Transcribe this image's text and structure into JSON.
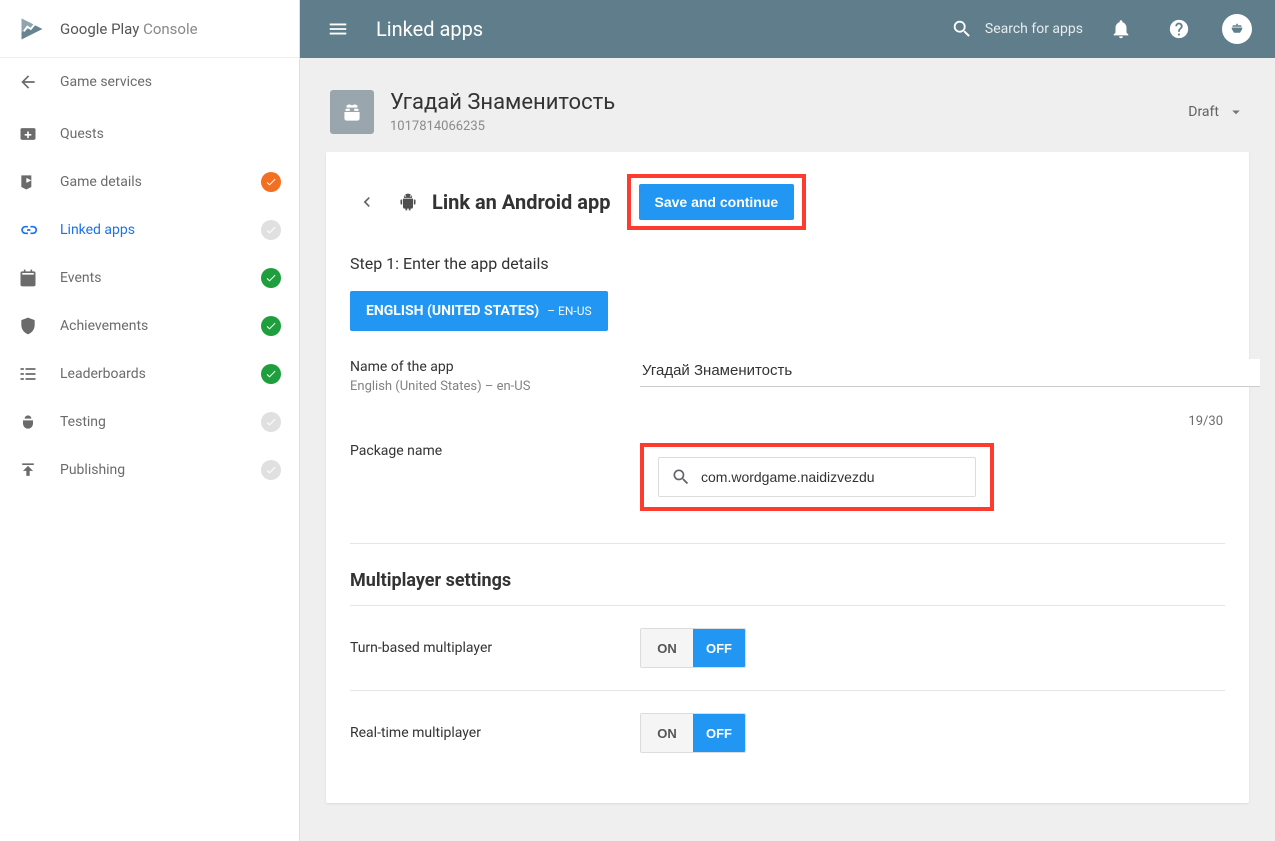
{
  "brand": {
    "name_strong": "Google Play",
    "name_light": " Console"
  },
  "sidebar": {
    "back_label": "Game services",
    "items": [
      {
        "label": "Quests",
        "icon": "add",
        "status": "none"
      },
      {
        "label": "Game details",
        "icon": "card",
        "status": "orange"
      },
      {
        "label": "Linked apps",
        "icon": "link",
        "status": "gray",
        "active": true
      },
      {
        "label": "Events",
        "icon": "event",
        "status": "green"
      },
      {
        "label": "Achievements",
        "icon": "shield",
        "status": "green"
      },
      {
        "label": "Leaderboards",
        "icon": "list",
        "status": "green"
      },
      {
        "label": "Testing",
        "icon": "bug",
        "status": "gray"
      },
      {
        "label": "Publishing",
        "icon": "publish",
        "status": "gray"
      }
    ]
  },
  "topbar": {
    "title": "Linked apps",
    "search_placeholder": "Search for apps"
  },
  "appHeader": {
    "title": "Угадай Знаменитость",
    "id": "1017814066235",
    "status": "Draft"
  },
  "card": {
    "title": "Link an Android app",
    "save_label": "Save and continue",
    "step1": {
      "title": "Step 1: Enter the app details",
      "lang_chip_main": "ENGLISH (UNITED STATES)",
      "lang_chip_sub": "– EN-US",
      "name_label": "Name of the app",
      "name_sublabel": "English (United States) – en-US",
      "name_value": "Угадай Знаменитость",
      "char_count": "19/30",
      "package_label": "Package name",
      "package_value": "com.wordgame.naidizvezdu"
    },
    "mp": {
      "section_title": "Multiplayer settings",
      "turn_label": "Turn-based multiplayer",
      "rt_label": "Real-time multiplayer",
      "on": "ON",
      "off": "OFF"
    }
  }
}
